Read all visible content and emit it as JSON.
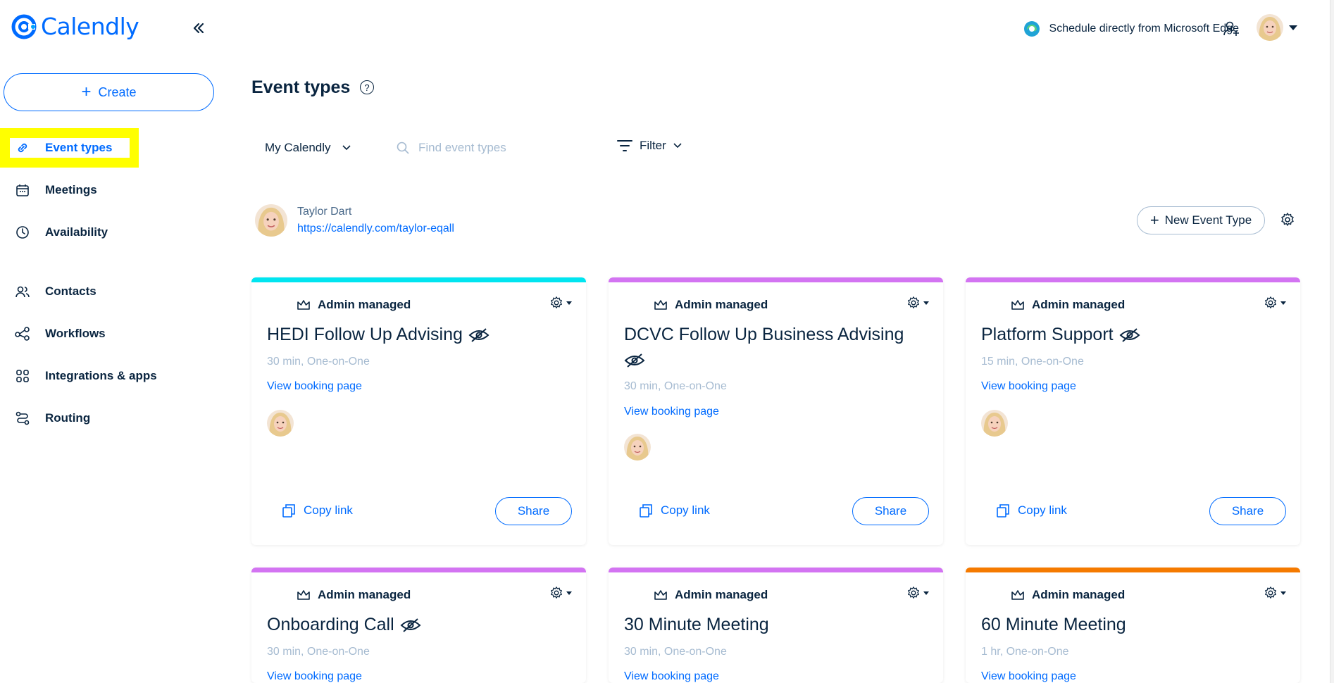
{
  "app": {
    "name": "Calendly",
    "brand_color": "#006bff"
  },
  "sidebar": {
    "create_label": "Create",
    "items": [
      {
        "label": "Event types",
        "icon": "link-icon",
        "active": true
      },
      {
        "label": "Meetings",
        "icon": "calendar-icon"
      },
      {
        "label": "Availability",
        "icon": "clock-icon"
      },
      {
        "label": "Contacts",
        "icon": "contacts-icon"
      },
      {
        "label": "Workflows",
        "icon": "workflows-icon"
      },
      {
        "label": "Integrations & apps",
        "icon": "grid-icon"
      },
      {
        "label": "Routing",
        "icon": "routing-icon"
      }
    ]
  },
  "header": {
    "edge_text": "Schedule directly from Microsoft Edge"
  },
  "main": {
    "title": "Event types",
    "calendar_select": "My Calendly",
    "search_placeholder": "Find event types",
    "filter_label": "Filter",
    "user": {
      "name": "Taylor Dart",
      "url": "https://calendly.com/taylor-eqall"
    },
    "new_event_label": "New Event Type"
  },
  "cards": [
    {
      "color": "#00e5f0",
      "badge": "Admin managed",
      "title": "HEDI Follow Up Advising",
      "hidden": true,
      "meta": "30 min, One-on-One",
      "view": "View booking page",
      "copy": "Copy link",
      "share": "Share"
    },
    {
      "color": "#d374f2",
      "badge": "Admin managed",
      "title": "DCVC Follow Up Business Advising",
      "hidden": true,
      "meta": "30 min, One-on-One",
      "view": "View booking page",
      "copy": "Copy link",
      "share": "Share"
    },
    {
      "color": "#d374f2",
      "badge": "Admin managed",
      "title": "Platform Support",
      "hidden": true,
      "meta": "15 min, One-on-One",
      "view": "View booking page",
      "copy": "Copy link",
      "share": "Share"
    },
    {
      "color": "#d374f2",
      "badge": "Admin managed",
      "title": "Onboarding Call",
      "hidden": true,
      "meta": "30 min, One-on-One",
      "view": "View booking page"
    },
    {
      "color": "#d374f2",
      "badge": "Admin managed",
      "title": "30 Minute Meeting",
      "hidden": false,
      "meta": "30 min, One-on-One",
      "view": "View booking page"
    },
    {
      "color": "#f57a00",
      "badge": "Admin managed",
      "title": "60 Minute Meeting",
      "hidden": false,
      "meta": "1 hr, One-on-One",
      "view": "View booking page"
    }
  ]
}
